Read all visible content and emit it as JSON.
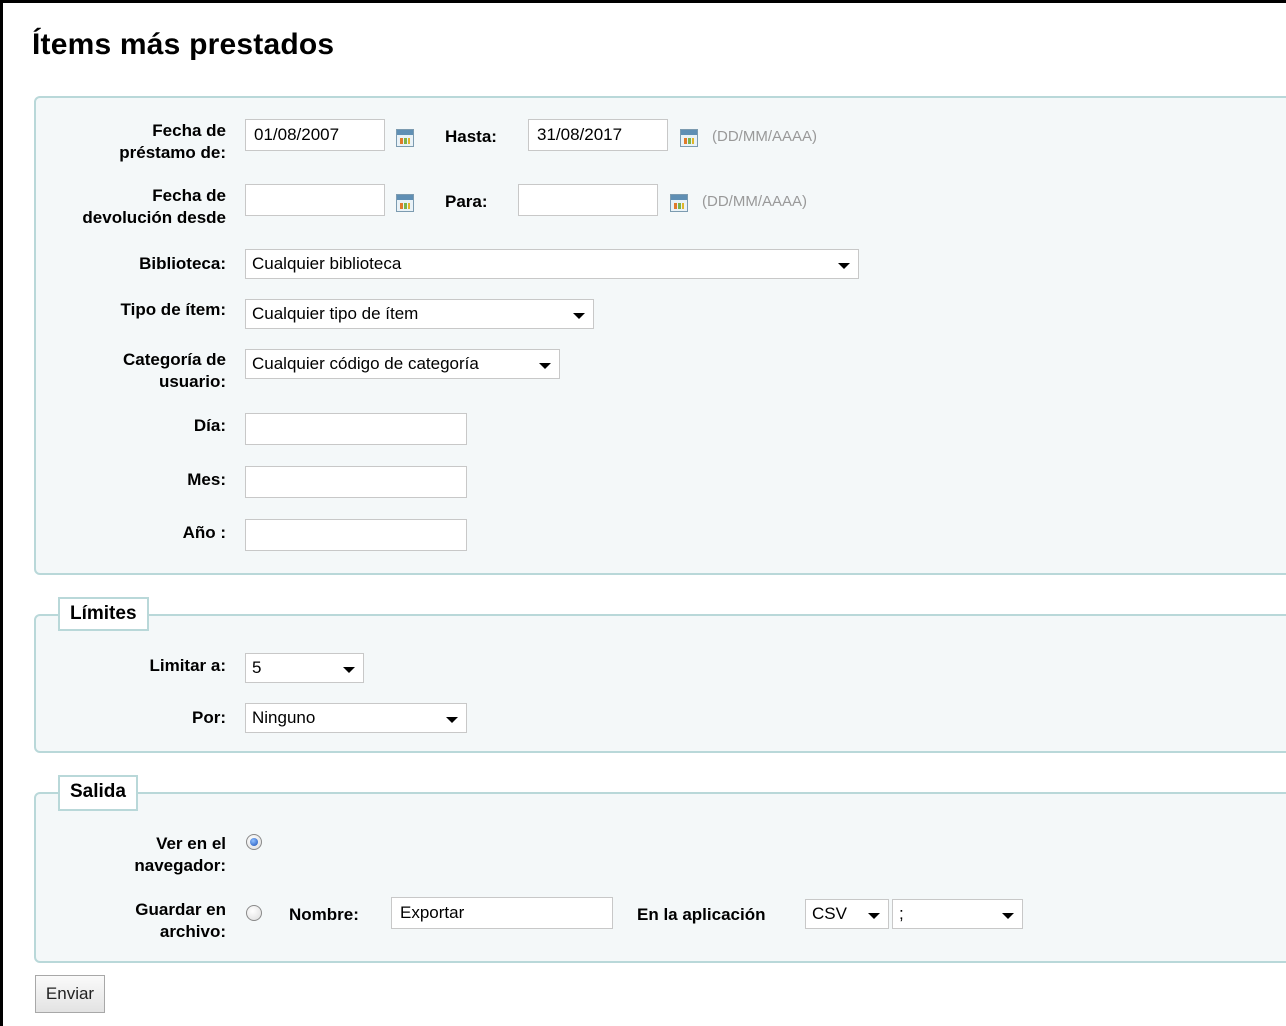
{
  "page": {
    "title": "Ítems más prestados"
  },
  "filters": {
    "loan_date": {
      "label": "Fecha de préstamo de:",
      "from": "01/08/2007",
      "to_label": "Hasta:",
      "to": "31/08/2017",
      "format": "(DD/MM/AAAA)"
    },
    "return_date": {
      "label": "Fecha de devolución desde",
      "from": "",
      "to_label": "Para:",
      "to": "",
      "format": "(DD/MM/AAAA)"
    },
    "library": {
      "label": "Biblioteca:",
      "value": "Cualquier biblioteca"
    },
    "item_type": {
      "label": "Tipo de ítem:",
      "value": "Cualquier tipo de ítem"
    },
    "patron_category": {
      "label": "Categoría de usuario:",
      "value": "Cualquier código de categoría"
    },
    "day": {
      "label": "Día:",
      "value": ""
    },
    "month": {
      "label": "Mes:",
      "value": ""
    },
    "year": {
      "label": "Año :",
      "value": ""
    }
  },
  "limits": {
    "legend": "Límites",
    "limit_to": {
      "label": "Limitar a:",
      "value": "5"
    },
    "by": {
      "label": "Por:",
      "value": "Ninguno"
    }
  },
  "output": {
    "legend": "Salida",
    "browser": {
      "label": "Ver en el navegador:",
      "selected": true
    },
    "file": {
      "label": "Guardar en archivo:",
      "selected": false
    },
    "name_label": "Nombre:",
    "name_value": "Exportar",
    "app_label": "En la aplicación",
    "format_value": "CSV",
    "separator_value": ";"
  },
  "submit": {
    "label": "Enviar"
  },
  "icons": {
    "calendar": "calendar-icon",
    "dropdown": "chevron-down-icon"
  }
}
